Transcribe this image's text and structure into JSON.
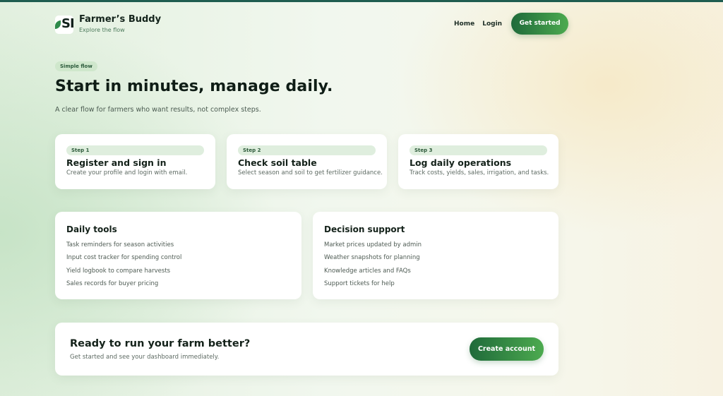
{
  "brand": {
    "name": "Farmer’s Buddy",
    "tagline": "Explore the flow",
    "logo_text": "SI"
  },
  "nav": {
    "home": "Home",
    "login": "Login",
    "cta": "Get started"
  },
  "hero": {
    "badge": "Simple flow",
    "title": "Start in minutes, manage daily.",
    "subtitle": "A clear flow for farmers who want results, not complex steps."
  },
  "steps": [
    {
      "label": "Step 1",
      "title": "Register and sign in",
      "desc": "Create your profile and login with email."
    },
    {
      "label": "Step 2",
      "title": "Check soil table",
      "desc": "Select season and soil to get fertilizer guidance."
    },
    {
      "label": "Step 3",
      "title": "Log daily operations",
      "desc": "Track costs, yields, sales, irrigation, and tasks."
    }
  ],
  "features": [
    {
      "title": "Daily tools",
      "items": [
        "Task reminders for season activities",
        "Input cost tracker for spending control",
        "Yield logbook to compare harvests",
        "Sales records for buyer pricing"
      ]
    },
    {
      "title": "Decision support",
      "items": [
        "Market prices updated by admin",
        "Weather snapshots for planning",
        "Knowledge articles and FAQs",
        "Support tickets for help"
      ]
    }
  ],
  "cta": {
    "title": "Ready to run your farm better?",
    "subtitle": "Get started and see your dashboard immediately.",
    "button": "Create account"
  },
  "colors": {
    "accent_dark": "#1f6a3a",
    "accent_light": "#4caa4f",
    "top_bar": "#1f5d50",
    "chip_bg": "#dfeede"
  }
}
